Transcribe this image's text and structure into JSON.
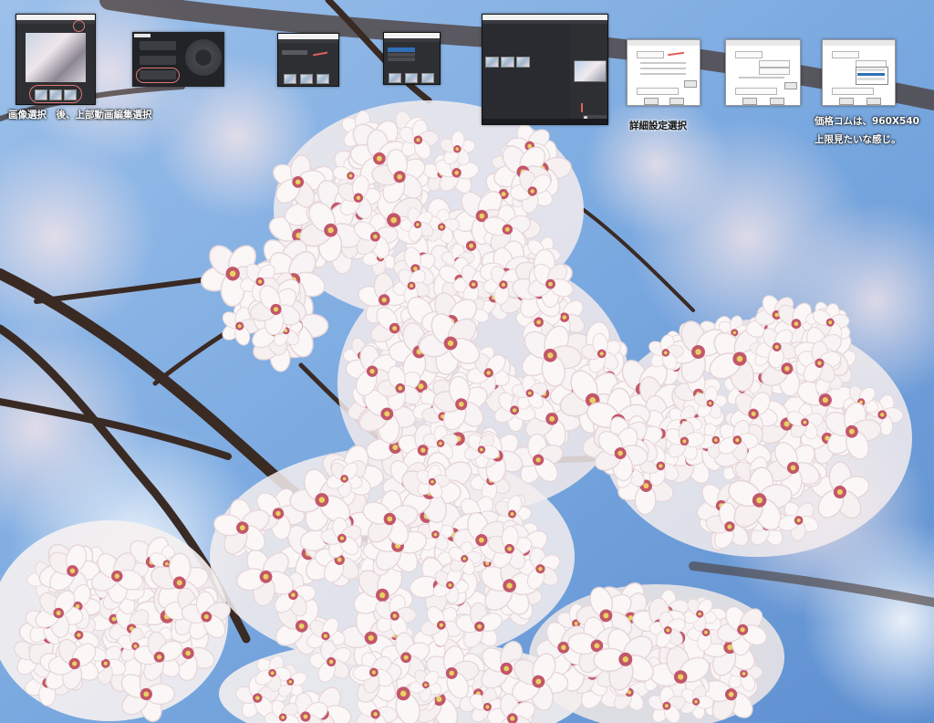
{
  "captions": {
    "step1": "画像選択　後、上部動画編集選択",
    "step2": "詳細設定選択",
    "step3": "価格コムは、960X540",
    "step3_line2": "上限見たいな感じ。"
  },
  "colors": {
    "sky": "#8fb6e3",
    "sky_deep": "#5f95d6",
    "blossom": "#f7f1f2",
    "blossom_center": "#c2576a",
    "branch": "#3a2a24",
    "annotation": "#e06060"
  },
  "icons": {
    "app_logo": "app-logo-icon",
    "dial": "dial-icon",
    "gear": "gear-icon"
  }
}
